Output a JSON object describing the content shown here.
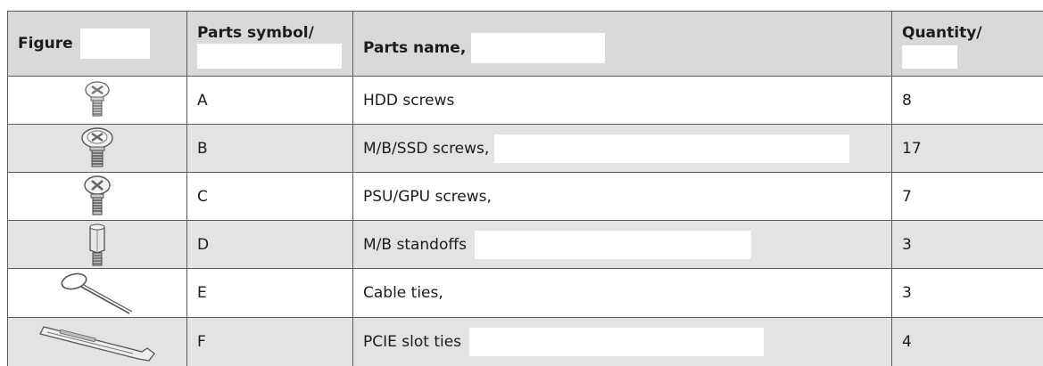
{
  "headers": {
    "figure": "Figure",
    "symbol": "Parts symbol/",
    "name": "Parts name,",
    "quantity": "Quantity/"
  },
  "rows": [
    {
      "icon": "hdd-screw-icon",
      "symbol": "A",
      "name": "HDD screws",
      "quantity": "8"
    },
    {
      "icon": "mb-ssd-screw-icon",
      "symbol": "B",
      "name": "M/B/SSD screws,",
      "quantity": "17"
    },
    {
      "icon": "psu-gpu-screw-icon",
      "symbol": "C",
      "name": "PSU/GPU screws,",
      "quantity": "7"
    },
    {
      "icon": "mb-standoff-icon",
      "symbol": "D",
      "name": "M/B standoffs",
      "quantity": "3"
    },
    {
      "icon": "cable-tie-icon",
      "symbol": "E",
      "name": "Cable ties,",
      "quantity": "3"
    },
    {
      "icon": "pcie-slot-icon",
      "symbol": "F",
      "name": "PCIE slot ties",
      "quantity": "4"
    }
  ]
}
